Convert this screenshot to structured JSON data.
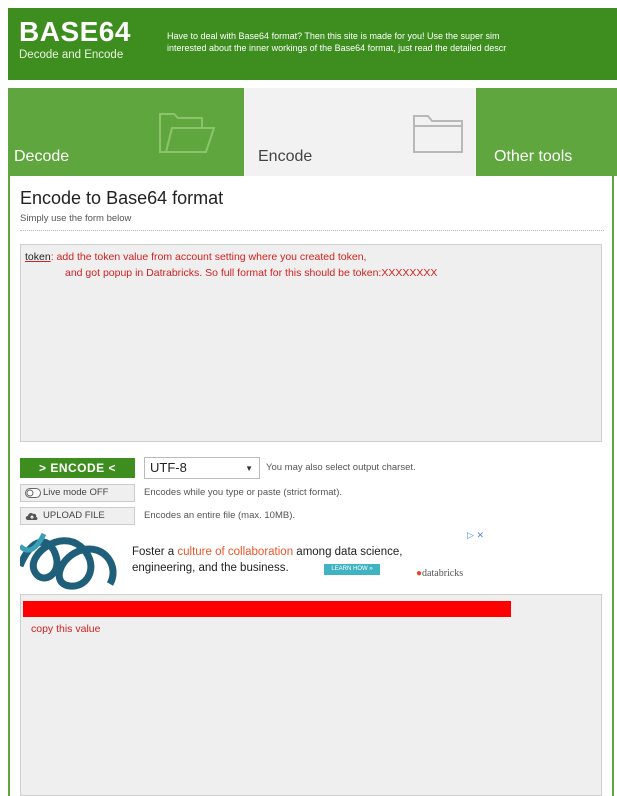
{
  "header": {
    "logo_title": "BASE64",
    "logo_subtitle": "Decode and Encode",
    "tagline_line1": "Have to deal with Base64 format? Then this site is made for you! Use the super sim",
    "tagline_line2": "interested about the inner workings of the Base64 format, just read the detailed descr"
  },
  "tabs": [
    {
      "label": "Decode",
      "active": false
    },
    {
      "label": "Encode",
      "active": true
    },
    {
      "label": "Other tools",
      "active": false
    }
  ],
  "main": {
    "title": "Encode to Base64 format",
    "subtitle": "Simply use the form below",
    "input": {
      "token_word": "token",
      "line1_rest": ": add the token value from account setting where you created token,",
      "line2": "and got popup in Datrabricks. So full format for this should be token:XXXXXXXX"
    },
    "encode_button": "> ENCODE <",
    "charset": {
      "selected": "UTF-8",
      "hint": "You may also select output charset."
    },
    "live_mode": {
      "label": "Live mode OFF",
      "hint": "Encodes while you type or paste (strict format)."
    },
    "upload": {
      "label": "UPLOAD FILE",
      "hint": "Encodes an entire file (max. 10MB)."
    },
    "output_note": "copy this value"
  },
  "ad": {
    "text_1": "Foster a ",
    "text_highlight": "culture of collaboration",
    "text_2": " among data science,",
    "text_3": "engineering, and the business.",
    "learn_button": "LEARN HOW »",
    "brand": "databricks"
  },
  "colors": {
    "brand_green": "#3e8e1f",
    "tab_green": "#5fa63e",
    "annotation_red": "#d32020",
    "redacted_bar": "#ff0000"
  }
}
